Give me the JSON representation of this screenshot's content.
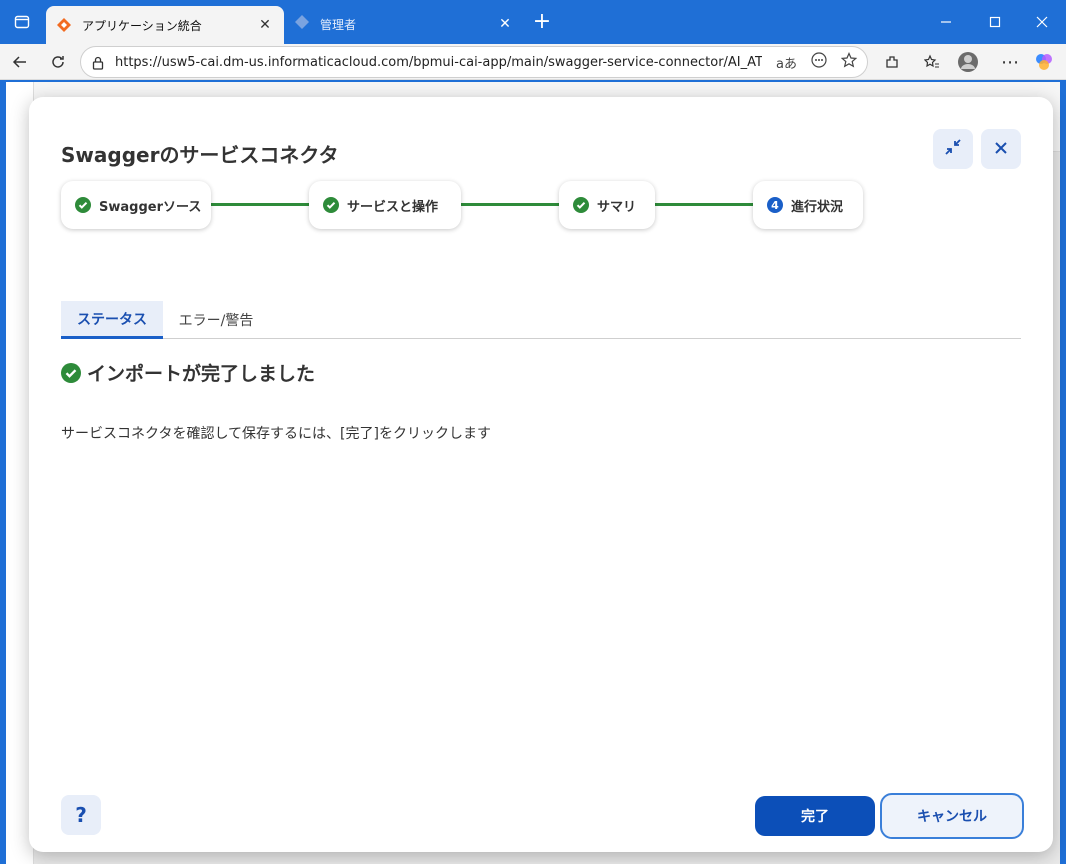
{
  "browser": {
    "tabs": [
      {
        "title": "アプリケーション統合",
        "active": true
      },
      {
        "title": "管理者",
        "active": false
      }
    ],
    "url": "https://usw5-cai.dm-us.informaticacloud.com/bpmui-cai-app/main/swagger-service-connector/AI_AT_S...",
    "reader_label": "aあ"
  },
  "modal": {
    "title": "Swaggerのサービスコネクタ",
    "steps": [
      {
        "label": "Swaggerソース",
        "state": "done"
      },
      {
        "label": "サービスと操作",
        "state": "done"
      },
      {
        "label": "サマリ",
        "state": "done"
      },
      {
        "number": "4",
        "label": "進行状況",
        "state": "current"
      }
    ],
    "tabs": [
      {
        "label": "ステータス",
        "active": true
      },
      {
        "label": "エラー/警告",
        "active": false
      }
    ],
    "status_message": "インポートが完了しました",
    "info_text": "サービスコネクタを確認して保存するには、[完了]をクリックします",
    "help_label": "?",
    "finish_label": "完了",
    "cancel_label": "キャンセル"
  },
  "colors": {
    "chrome_blue": "#1f6fd6",
    "success_green": "#2e8b3a",
    "primary_blue": "#0c4fb8"
  }
}
